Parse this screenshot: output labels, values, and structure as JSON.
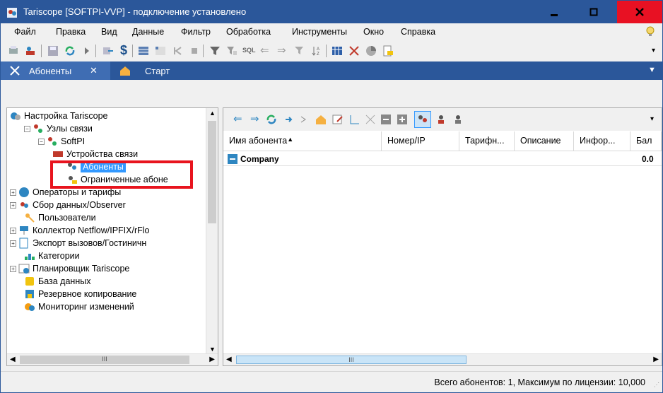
{
  "window": {
    "title": "Tariscope [SOFTPI-VVP] - подключение установлено"
  },
  "menu": [
    "Файл",
    "Правка",
    "Вид",
    "Данные",
    "Фильтр",
    "Обработка",
    "Инструменты",
    "Окно",
    "Справка"
  ],
  "tabs": {
    "active": "Абоненты",
    "close": "✕",
    "start": "Старт"
  },
  "tree": {
    "root": "Настройка Tariscope",
    "nodes": "Узлы связи",
    "softpi": "SoftPI",
    "devices": "Устройства связи",
    "subscribers": "Абоненты",
    "limited": "Ограниченные абоне",
    "operators": "Операторы и тарифы",
    "collect": "Сбор данных/Observer",
    "users": "Пользователи",
    "netflow": "Коллектор Netflow/IPFIX/rFlo",
    "export": "Экспорт вызовов/Гостиничн",
    "categories": "Категории",
    "scheduler": "Планировщик Tariscope",
    "db": "База данных",
    "backup": "Резервное копирование",
    "monitoring": "Мониторинг изменений"
  },
  "grid": {
    "columns": [
      "Имя абонента",
      "Номер/IP",
      "Тарифн...",
      "Описание",
      "Инфор...",
      "Бал"
    ],
    "group": "Company",
    "group_value": "0.0",
    "scroll_mark": "III"
  },
  "tree_scroll_mark": "III",
  "status": "Всего абонентов: 1, Максимум по лицензии: 10,000"
}
